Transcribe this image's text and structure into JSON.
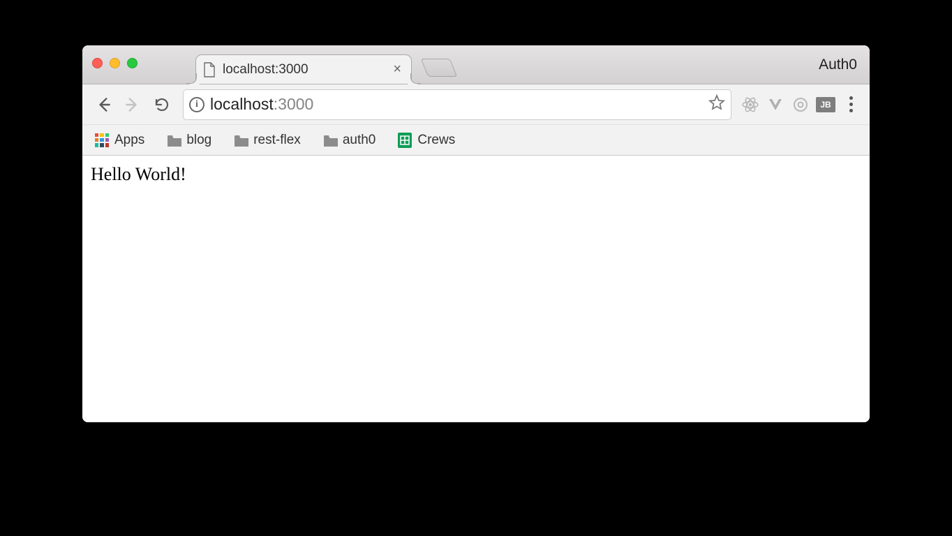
{
  "window": {
    "profile_label": "Auth0"
  },
  "tab": {
    "title": "localhost:3000"
  },
  "toolbar": {
    "url_host": "localhost",
    "url_path": ":3000"
  },
  "bookmarks": {
    "apps_label": "Apps",
    "items": [
      {
        "label": "blog"
      },
      {
        "label": "rest-flex"
      },
      {
        "label": "auth0"
      },
      {
        "label": "Crews"
      }
    ]
  },
  "extensions": {
    "jb_label": "JB"
  },
  "page": {
    "body_text": "Hello World!"
  }
}
